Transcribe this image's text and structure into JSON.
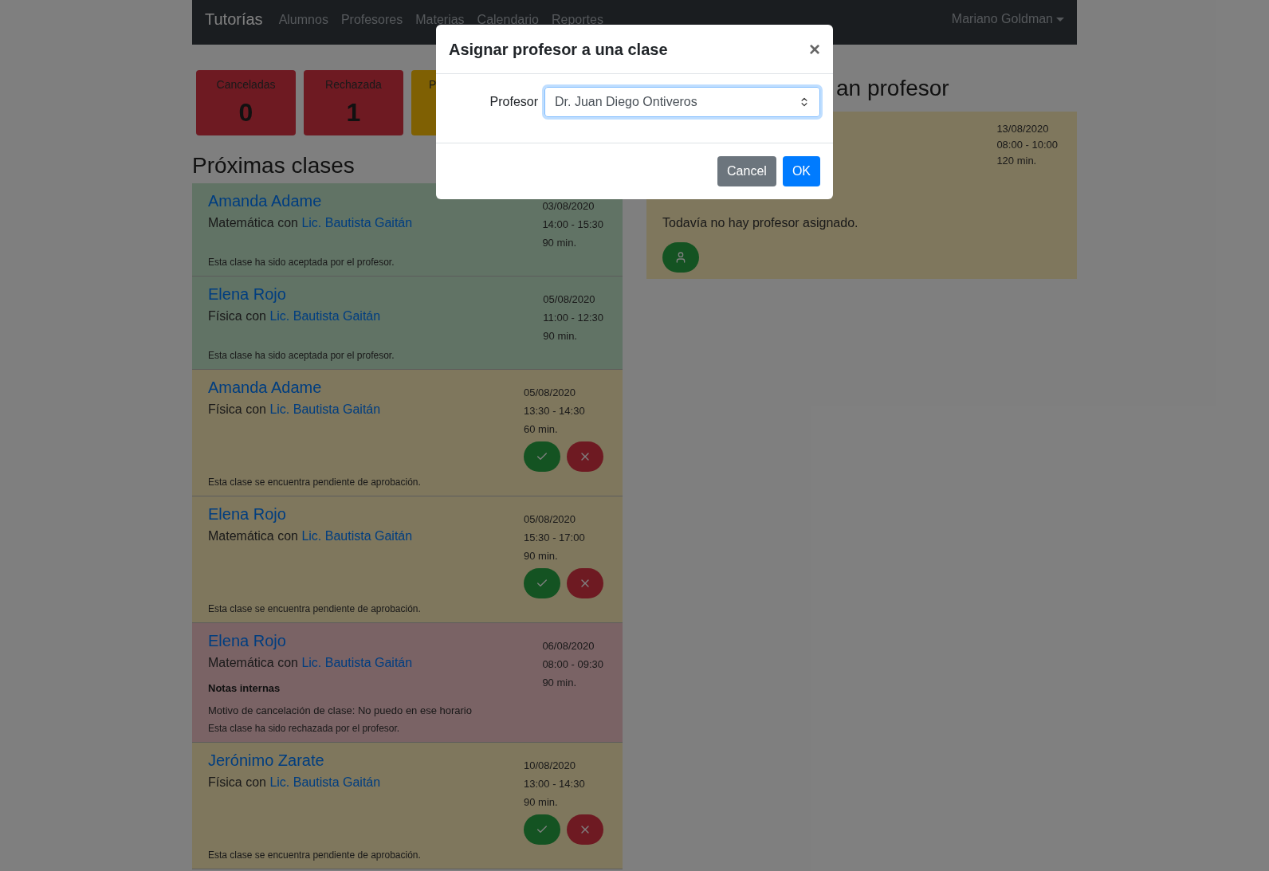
{
  "navbar": {
    "brand": "Tutorías",
    "links": [
      "Alumnos",
      "Profesores",
      "Materias",
      "Calendario",
      "Reportes"
    ],
    "user": "Mariano Goldman"
  },
  "stats": [
    {
      "label": "Canceladas",
      "value": "0",
      "kind": "danger"
    },
    {
      "label": "Rechazada",
      "value": "1",
      "kind": "danger"
    },
    {
      "label": "P",
      "kind": "warning"
    }
  ],
  "upcoming": {
    "title": "Próximas clases",
    "classes": [
      {
        "student": "Amanda Adame",
        "subject": "Matemática",
        "with": "con",
        "teacher": "Lic. Bautista Gaitán",
        "date": "03/08/2020",
        "time": "14:00 - 15:30",
        "duration": "90 min.",
        "kind": "accepted",
        "message": "Esta clase ha sido aceptada por el profesor."
      },
      {
        "student": "Elena Rojo",
        "subject": "Física",
        "with": "con",
        "teacher": "Lic. Bautista Gaitán",
        "date": "05/08/2020",
        "time": "11:00 - 12:30",
        "duration": "90 min.",
        "kind": "accepted",
        "message": "Esta clase ha sido aceptada por el profesor."
      },
      {
        "student": "Amanda Adame",
        "subject": "Física",
        "with": "con",
        "teacher": "Lic. Bautista Gaitán",
        "date": "05/08/2020",
        "time": "13:30 - 14:30",
        "duration": "60 min.",
        "kind": "pending",
        "message": "Esta clase se encuentra pendiente de aprobación."
      },
      {
        "student": "Elena Rojo",
        "subject": "Matemática",
        "with": "con",
        "teacher": "Lic. Bautista Gaitán",
        "date": "05/08/2020",
        "time": "15:30 - 17:00",
        "duration": "90 min.",
        "kind": "pending",
        "message": "Esta clase se encuentra pendiente de aprobación."
      },
      {
        "student": "Elena Rojo",
        "subject": "Matemática",
        "with": "con",
        "teacher": "Lic. Bautista Gaitán",
        "date": "06/08/2020",
        "time": "08:00 - 09:30",
        "duration": "90 min.",
        "kind": "rejected",
        "notes_title": "Notas internas",
        "notes": "Motivo de cancelación de clase: No puedo en ese horario",
        "message": "Esta clase ha sido rechazada por el profesor."
      },
      {
        "student": "Jerónimo Zarate",
        "subject": "Física",
        "with": "con",
        "teacher": "Lic. Bautista Gaitán",
        "date": "10/08/2020",
        "time": "13:00 - 14:30",
        "duration": "90 min.",
        "kind": "pending",
        "message": "Esta clase se encuentra pendiente de aprobación."
      }
    ]
  },
  "unassigned": {
    "title": "an profesor",
    "classes": [
      {
        "date": "13/08/2020",
        "time": "08:00 - 10:00",
        "duration": "120 min.",
        "message": "Todavía no hay profesor asignado."
      }
    ]
  },
  "modal": {
    "title": "Asignar profesor a una clase",
    "close": "×",
    "field_label": "Profesor",
    "value": "Dr. Juan Diego Ontiveros",
    "buttons": [
      {
        "label": "Cancel",
        "kind": "secondary"
      },
      {
        "label": "OK",
        "kind": "primary"
      }
    ]
  }
}
